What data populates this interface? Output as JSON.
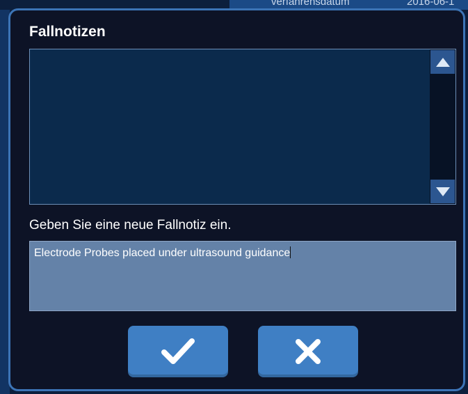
{
  "background": {
    "header_fragments": [
      "verfahrensdatum",
      "2016-06-1"
    ]
  },
  "dialog": {
    "title": "Fallnotizen",
    "notes_list": {
      "entries": [],
      "scroll_up_icon": "triangle-up-icon",
      "scroll_down_icon": "triangle-down-icon"
    },
    "new_note": {
      "label": "Geben Sie eine neue Fallnotiz ein.",
      "value": "Electrode Probes placed under ultrasound guidance"
    },
    "buttons": {
      "confirm_icon": "checkmark-icon",
      "cancel_icon": "x-icon"
    }
  },
  "colors": {
    "dialog_bg": "#0d1326",
    "dialog_border": "#3c74b6",
    "notes_bg": "#0b2a4c",
    "input_bg": "#6482a8",
    "button_bg": "#3f7fc4",
    "scroll_btn_bg": "#2c5690"
  }
}
